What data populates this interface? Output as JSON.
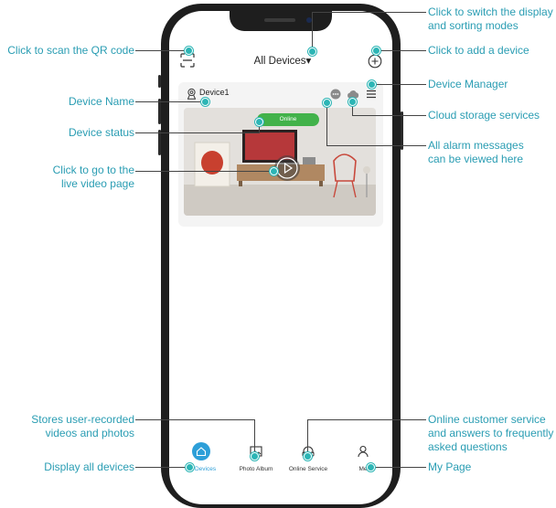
{
  "app": {
    "title": "All Devices▾",
    "device": {
      "name": "Device1",
      "status": "Online"
    },
    "nav": [
      {
        "label": "All Devices",
        "icon": "home-icon",
        "active": true
      },
      {
        "label": "Photo Album",
        "icon": "photo-album-icon",
        "active": false
      },
      {
        "label": "Online Service",
        "icon": "headset-icon",
        "active": false
      },
      {
        "label": "Me",
        "icon": "person-icon",
        "active": false
      }
    ]
  },
  "annotations": {
    "scan_qr": "Click to scan the QR code",
    "switch_display": [
      "Click to switch the display",
      "and sorting modes"
    ],
    "add_device": "Click to add a device",
    "device_manager": "Device Manager",
    "device_name": "Device Name",
    "cloud_storage": "Cloud storage services",
    "device_status": "Device status",
    "alarm_messages": [
      "All alarm messages",
      "can be viewed here"
    ],
    "live_video": [
      "Click to go to the",
      "live video page"
    ],
    "stores_recorded": [
      "Stores user-recorded",
      "videos and photos"
    ],
    "online_service": [
      "Online customer service",
      "and answers to frequently",
      "asked questions"
    ],
    "display_all": "Display all devices",
    "my_page": "My Page"
  },
  "colors": {
    "accent": "#2d9fd8",
    "annotation": "#2a9db3",
    "online": "#42b24a"
  }
}
